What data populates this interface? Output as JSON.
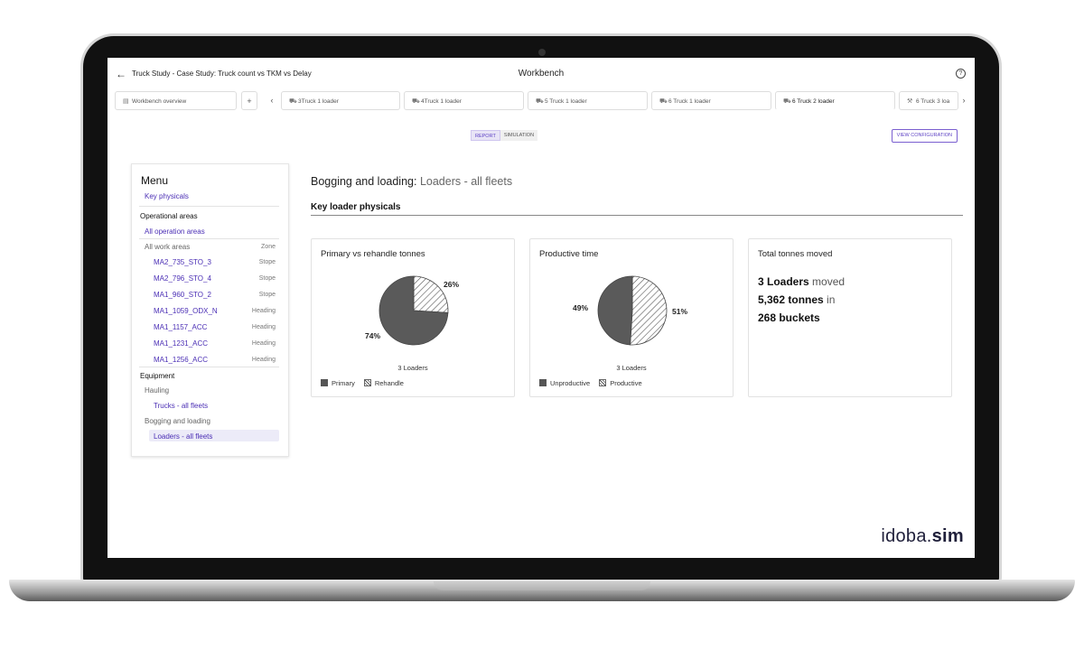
{
  "header": {
    "breadcrumb": "Truck Study - Case Study: Truck count vs TKM vs Delay",
    "title": "Workbench"
  },
  "tabs": {
    "items": [
      {
        "label": "Workbench overview",
        "icon": "table-icon"
      },
      {
        "label": "3Truck 1 loader",
        "icon": "truck-icon"
      },
      {
        "label": "4Truck 1 loader",
        "icon": "truck-icon"
      },
      {
        "label": "5 Truck 1 loader",
        "icon": "truck-icon"
      },
      {
        "label": "6 Truck 1 loader",
        "icon": "truck-icon"
      },
      {
        "label": "6 Truck 2 loader",
        "icon": "truck-icon"
      },
      {
        "label": "6 Truck 3 loa",
        "icon": "tools-icon"
      }
    ],
    "add": "+",
    "prev": "‹",
    "next": "›"
  },
  "mode": {
    "report": "REPORT",
    "simulation": "SIMULATION"
  },
  "view_config": "VIEW CONFIGURATION",
  "menu": {
    "title": "Menu",
    "key_physicals": "Key physicals",
    "operational_areas": "Operational areas",
    "all_operation_areas": "All operation areas",
    "all_work_areas": "All work areas",
    "zone": "Zone",
    "areas": [
      {
        "name": "MA2_735_STO_3",
        "type": "Stope"
      },
      {
        "name": "MA2_796_STO_4",
        "type": "Stope"
      },
      {
        "name": "MA1_960_STO_2",
        "type": "Stope"
      },
      {
        "name": "MA1_1059_ODX_N",
        "type": "Heading"
      },
      {
        "name": "MA1_1157_ACC",
        "type": "Heading"
      },
      {
        "name": "MA1_1231_ACC",
        "type": "Heading"
      },
      {
        "name": "MA1_1256_ACC",
        "type": "Heading"
      }
    ],
    "equipment": "Equipment",
    "hauling": "Hauling",
    "trucks": "Trucks - all fleets",
    "bogging": "Bogging and loading",
    "loaders": "Loaders - all fleets"
  },
  "page": {
    "title_main": "Bogging and loading: ",
    "title_sub": "Loaders - all fleets",
    "section": "Key loader physicals"
  },
  "cards": {
    "primary": {
      "title": "Primary vs rehandle tonnes",
      "caption": "3 Loaders",
      "legend": [
        "Primary",
        "Rehandle"
      ],
      "labels": [
        "74%",
        "26%"
      ]
    },
    "productive": {
      "title": "Productive time",
      "caption": "3 Loaders",
      "legend": [
        "Unproductive",
        "Productive"
      ],
      "labels": [
        "49%",
        "51%"
      ]
    },
    "total": {
      "title": "Total tonnes moved",
      "line1_bold": "3 Loaders",
      "line1_rest": " moved",
      "line2_bold": "5,362 tonnes",
      "line2_rest": " in",
      "line3_bold": "268 buckets"
    }
  },
  "chart_data": [
    {
      "type": "pie",
      "title": "Primary vs rehandle tonnes",
      "categories": [
        "Primary",
        "Rehandle"
      ],
      "values": [
        74,
        26
      ]
    },
    {
      "type": "pie",
      "title": "Productive time",
      "categories": [
        "Unproductive",
        "Productive"
      ],
      "values": [
        49,
        51
      ]
    }
  ],
  "brand": {
    "name": "idoba",
    "dot": ".",
    "suffix": "sim"
  },
  "colors": {
    "accent": "#5b3fc4",
    "solid": "#5a5a5a"
  }
}
